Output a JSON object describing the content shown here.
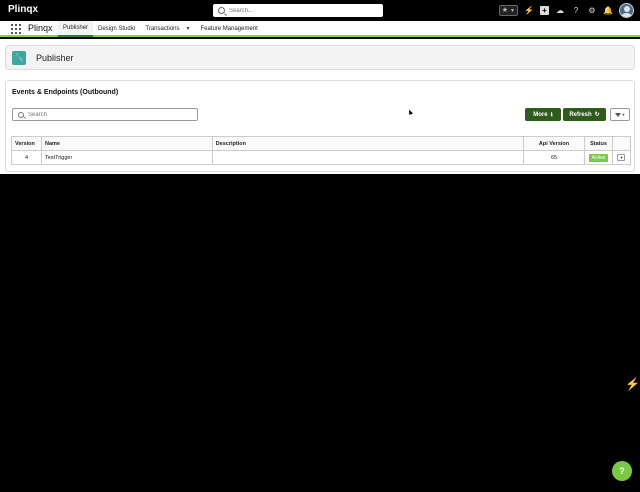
{
  "header": {
    "brand": "Plinqx",
    "search_placeholder": "Search...",
    "icons": [
      "favorites-icon",
      "bolt-icon",
      "add-icon",
      "trailhead-icon",
      "help-icon",
      "settings-icon",
      "notifications-icon",
      "avatar"
    ]
  },
  "nav": {
    "app_name": "Plinqx",
    "tabs": [
      {
        "label": "Publisher",
        "active": true
      },
      {
        "label": "Design Studio",
        "active": false
      },
      {
        "label": "Transactions",
        "active": false,
        "dropdown": true
      },
      {
        "label": "Feature Management",
        "active": false
      }
    ]
  },
  "page": {
    "title": "Publisher"
  },
  "card": {
    "title": "Events & Endpoints (Outbound)",
    "search_placeholder": "Search",
    "more_label": "More",
    "refresh_label": "Refresh"
  },
  "table": {
    "columns": [
      "Version",
      "Name",
      "Description",
      "Api Version",
      "Status"
    ],
    "rows": [
      {
        "version": "4",
        "name": "TestTrigger",
        "description": "",
        "api_version": "65",
        "status": "Active"
      }
    ]
  },
  "colors": {
    "brand_green": "#2f5b1e",
    "accent_green": "#7ac943",
    "nav_underline": "#8bcf3c",
    "publisher_icon": "#3aa89a",
    "bolt": "#f0c419"
  },
  "floating": {
    "help_label": "?"
  }
}
